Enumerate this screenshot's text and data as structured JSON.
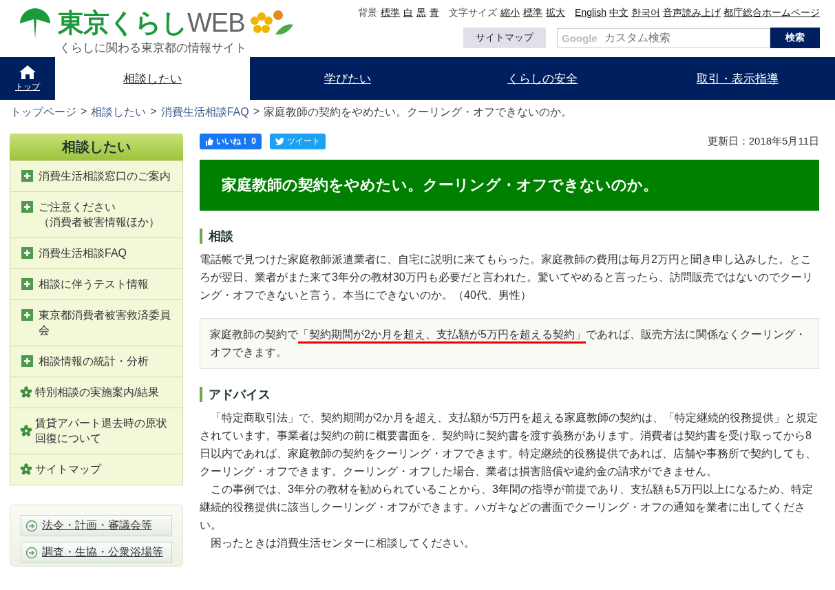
{
  "header": {
    "logo": {
      "title_main": "東京くらし",
      "title_web": "WEB",
      "tagline": "くらしに関わる東京都の情報サイト"
    },
    "background": {
      "label": "背景",
      "options": [
        "標準",
        "白",
        "黒",
        "青"
      ]
    },
    "font_size": {
      "label": "文字サイズ",
      "options": [
        "縮小",
        "標準",
        "拡大"
      ]
    },
    "links": [
      "English",
      "中文",
      "한국어",
      "音声読み上げ",
      "都庁総合ホームページ"
    ],
    "sitemap_button": "サイトマップ",
    "search": {
      "placeholder": "カスタム検索",
      "brand": "Google",
      "button": "検索"
    }
  },
  "nav": {
    "home": "トップ",
    "tabs": [
      {
        "label": "相談したい",
        "selected": true
      },
      {
        "label": "学びたい",
        "selected": false
      },
      {
        "label": "くらしの安全",
        "selected": false
      },
      {
        "label": "取引・表示指導",
        "selected": false
      }
    ]
  },
  "breadcrumb": {
    "separator": ">",
    "links": [
      "トップページ",
      "相談したい",
      "消費生活相談FAQ"
    ],
    "current": "家庭教師の契約をやめたい。クーリング・オフできないのか。"
  },
  "sidebar": {
    "title": "相談したい",
    "items": [
      {
        "kind": "plus",
        "label": "消費生活相談窓口のご案内"
      },
      {
        "kind": "plus",
        "label": "ご注意ください",
        "sublabel": "（消費者被害情報ほか）"
      },
      {
        "kind": "plus",
        "label": "消費生活相談FAQ"
      },
      {
        "kind": "plus",
        "label": "相談に伴うテスト情報"
      },
      {
        "kind": "plus",
        "label": "東京都消費者被害救済委員会"
      },
      {
        "kind": "plus",
        "label": "相談情報の統計・分析"
      },
      {
        "kind": "star",
        "label": "特別相談の実施案内/結果"
      },
      {
        "kind": "star",
        "label": "賃貸アパート退去時の原状回復について"
      },
      {
        "kind": "star",
        "label": "サイトマップ"
      }
    ],
    "links": [
      "法令・計画・審議会等",
      "調査・生協・公衆浴場等"
    ]
  },
  "article": {
    "like": {
      "label": "いいね！",
      "count": "0"
    },
    "tweet": "ツイート",
    "updated": "更新日：2018年5月11日",
    "title": "家庭教師の契約をやめたい。クーリング・オフできないのか。",
    "sections": [
      {
        "heading": "相談",
        "paragraphs": [
          "電話帳で見つけた家庭教師派遣業者に、自宅に説明に来てもらった。家庭教師の費用は毎月2万円と聞き申し込みした。ところが翌日、業者がまた来て3年分の教材30万円も必要だと言われた。驚いてやめると言ったら、訪問販売ではないのでクーリング・オフできないと言う。本当にできないのか。（40代、男性）"
        ],
        "indent": false,
        "answer": [
          {
            "text": "家庭教師の契約で",
            "underlined": false
          },
          {
            "text": "「契約期間が2か月を超え、支払額が5万円を超える契約」",
            "underlined": true
          },
          {
            "text": "であれば、販売方法に関係なくクーリング・オフできます。",
            "underlined": false
          }
        ]
      },
      {
        "heading": "アドバイス",
        "indent": true,
        "paragraphs": [
          "「特定商取引法」で、契約期間が2か月を超え、支払額が5万円を超える家庭教師の契約は、「特定継続的役務提供」と規定されています。事業者は契約の前に概要書面を、契約時に契約書を渡す義務があります。消費者は契約書を受け取ってから8日以内であれば、家庭教師の契約をクーリング・オフできます。特定継続的役務提供であれば、店舗や事務所で契約しても、クーリング・オフできます。クーリング・オフした場合、業者は損害賠償や違約金の請求ができません。",
          "この事例では、3年分の教材を勧められていることから、3年間の指導が前提であり、支払額も5万円以上になるため、特定継続的役務提供に該当しクーリング・オフができます。ハガキなどの書面でクーリング・オフの通知を業者に出してください。",
          "困ったときは消費生活センターに相談してください。"
        ]
      }
    ]
  }
}
